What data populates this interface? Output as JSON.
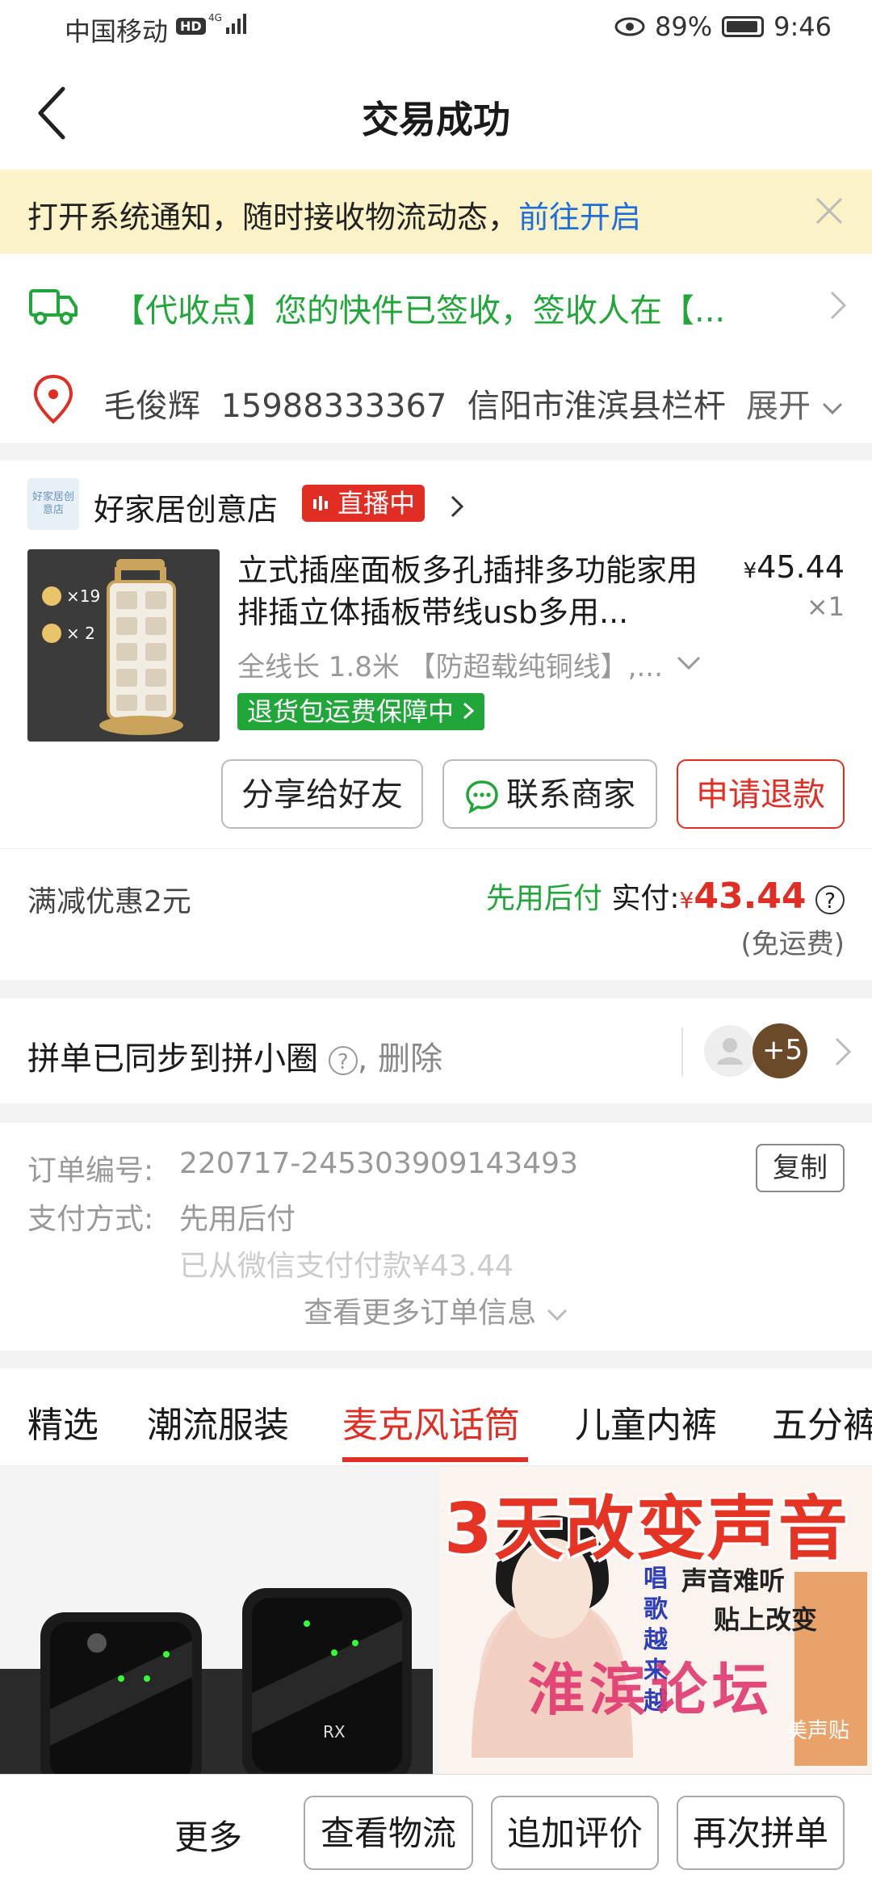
{
  "status_bar": {
    "carrier": "中国移动",
    "hd": "HD",
    "network": "4G",
    "battery": "89%",
    "time": "9:46"
  },
  "header": {
    "title": "交易成功"
  },
  "notify": {
    "text": "打开系统通知，随时接收物流动态，",
    "link": "前往开启"
  },
  "logistics": {
    "text": "【代收点】您的快件已签收，签收人在【..."
  },
  "address": {
    "name": "毛俊辉",
    "phone": "15988333367",
    "addr": "信阳市淮滨县栏杆",
    "expand": "展开"
  },
  "store": {
    "logo_text": "好家居创意店",
    "name": "好家居创意店",
    "live_label": "直播中",
    "product": {
      "title": "立式插座面板多孔插排多功能家用排插立体插板带线usb多用...",
      "price_symbol": "¥",
      "price": "45.44",
      "qty": "×1",
      "spec": "全线长 1.8米 【防超载纯铜线】,...",
      "badge": "退货包运费保障中",
      "img_label1": "×19",
      "img_label2": "× 2"
    },
    "buttons": {
      "share": "分享给好友",
      "contact": "联系商家",
      "refund": "申请退款"
    }
  },
  "payment": {
    "discount": "满减优惠2元",
    "pay_later": "先用后付",
    "paid_label": "实付:",
    "currency": "¥",
    "amount": "43.44",
    "shipping": "(免运费)"
  },
  "sync": {
    "text": "拼单已同步到拼小圈",
    "delete": ", 删除",
    "count": "+5"
  },
  "order_info": {
    "order_no_label": "订单编号:",
    "order_no": "220717-245303909143493",
    "copy": "复制",
    "pay_method_label": "支付方式:",
    "pay_method": "先用后付",
    "paid_note": "已从微信支付付款¥43.44",
    "see_more": "查看更多订单信息"
  },
  "tabs": [
    "精选",
    "潮流服装",
    "麦克风话筒",
    "儿童内裤",
    "五分裤"
  ],
  "active_tab": 2,
  "promo": {
    "title": "3天改变声音",
    "line1": "声音难听",
    "line2": "贴上改变",
    "vertical": "唱歌越来越",
    "brand": "淮滨论坛",
    "product": "美声贴"
  },
  "device_label": "RX",
  "bottom_bar": {
    "more": "更多",
    "logistics": "查看物流",
    "review": "追加评价",
    "rebuy": "再次拼单"
  },
  "colors": {
    "red": "#e02e24",
    "green": "#21a63a",
    "link": "#1f6fd8",
    "notify_bg": "#fbf2c7"
  }
}
